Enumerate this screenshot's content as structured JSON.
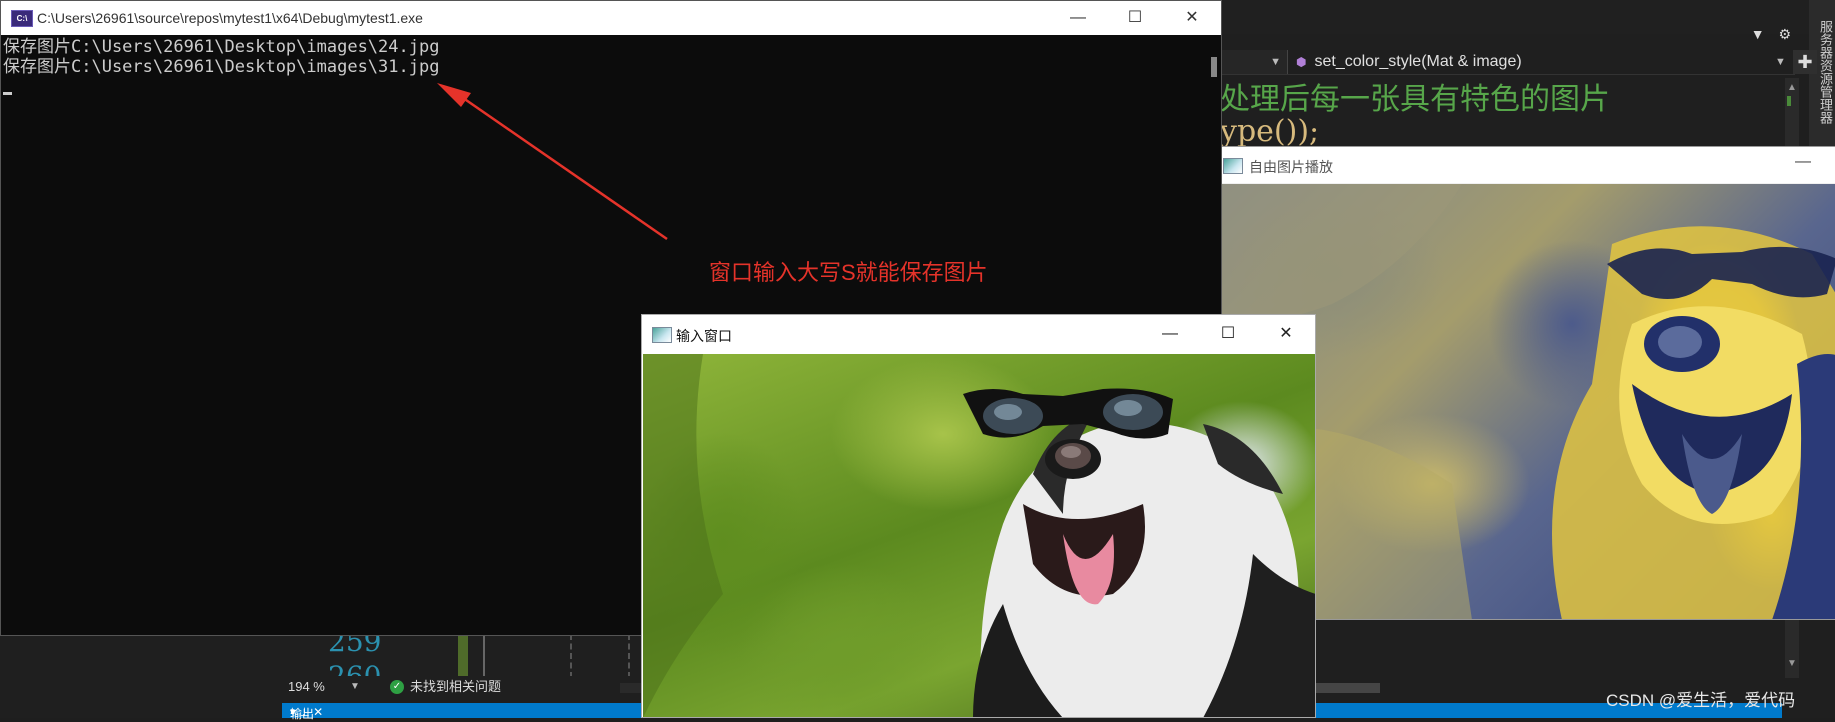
{
  "console": {
    "title": "C:\\Users\\26961\\source\\repos\\mytest1\\x64\\Debug\\mytest1.exe",
    "icon_text": "C:\\",
    "lines": [
      "保存图片C:\\Users\\26961\\Desktop\\images\\24.jpg",
      "保存图片C:\\Users\\26961\\Desktop\\images\\31.jpg"
    ],
    "controls": {
      "minimize": "—",
      "maximize": "☐",
      "close": "✕"
    }
  },
  "annotation": {
    "text": "窗口输入大写S就能保存图片",
    "color": "#e5332a"
  },
  "editor": {
    "function_nav": "set_color_style(Mat & image)",
    "code_comment": "处理后每一张具有特色的图片",
    "code_fragment": "ype());",
    "line_numbers": [
      "259",
      "260"
    ],
    "zoom": "194 %",
    "issues_text": "未找到相关问题",
    "output_tab": "输出",
    "side_panel_text": "服务器资源管理器",
    "toolbar_icons": [
      "dropdown-icon",
      "gear-icon"
    ]
  },
  "photo_window": {
    "title": "自由图片播放",
    "minimize": "—"
  },
  "input_window": {
    "title": "输入窗口",
    "controls": {
      "minimize": "—",
      "maximize": "☐",
      "close": "✕"
    }
  },
  "watermark": "CSDN @爱生活，爱代码"
}
